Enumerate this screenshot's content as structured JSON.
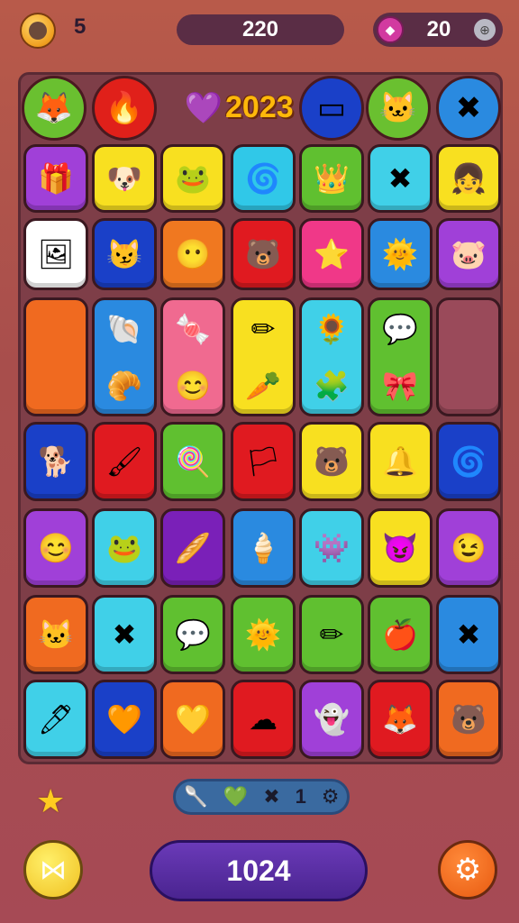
{
  "header": {
    "lives": "5",
    "score": "220",
    "gems": "20",
    "coin_icon": "coin-icon",
    "gem_icon": "gem-icon",
    "add_icon": "add-icon"
  },
  "board": {
    "year": "2023",
    "top_row": [
      {
        "icon": "fox-face-icon",
        "glyph": "🦊",
        "color": "#6ac030"
      },
      {
        "icon": "flame-icon",
        "glyph": "🔥",
        "color": "#e0201a"
      },
      {
        "icon": "heart-icon",
        "glyph": "💜",
        "color": "transparent"
      },
      {
        "icon": "eraser-icon",
        "glyph": "▭",
        "color": "#1a40c8"
      },
      {
        "icon": "cat-face-icon",
        "glyph": "🐱",
        "color": "#6ac030"
      },
      {
        "icon": "cross-icon",
        "glyph": "✖",
        "color": "#2a8ae0"
      }
    ],
    "rows": [
      [
        {
          "icon": "gift-icon",
          "glyph": "🎁",
          "color": "#a040d8"
        },
        {
          "icon": "dog-face-icon",
          "glyph": "🐶",
          "color": "#f8e020"
        },
        {
          "icon": "frog-face-icon",
          "glyph": "🐸",
          "color": "#f8e020"
        },
        {
          "icon": "swirl-icon",
          "glyph": "🌀",
          "color": "#30c8e8"
        },
        {
          "icon": "crown-icon",
          "glyph": "👑",
          "color": "#60c030"
        },
        {
          "icon": "cross-icon",
          "glyph": "✖",
          "color": "#40d0e8"
        },
        {
          "icon": "girl-face-icon",
          "glyph": "👧",
          "color": "#f8e020"
        }
      ],
      [
        {
          "icon": "frame-icon",
          "glyph": "🖼",
          "color": "#ffffff"
        },
        {
          "icon": "cat-face-icon",
          "glyph": "😼",
          "color": "#1a40c8"
        },
        {
          "icon": "ghost-face-icon",
          "glyph": "😶",
          "color": "#f07820"
        },
        {
          "icon": "bear-face-icon",
          "glyph": "🐻",
          "color": "#e01a20"
        },
        {
          "icon": "star-face-icon",
          "glyph": "⭐",
          "color": "#f03888"
        },
        {
          "icon": "sun-face-icon",
          "glyph": "🌞",
          "color": "#2a8ae0"
        },
        {
          "icon": "pig-face-icon",
          "glyph": "🐷",
          "color": "#a040d8"
        }
      ],
      [
        {
          "icon": "empty-tile",
          "glyph": "",
          "color": "#f06a20",
          "glyph2": ""
        },
        {
          "icon": "shell-icon",
          "glyph": "🐚",
          "color": "#2a8ae0",
          "glyph2": "🥐"
        },
        {
          "icon": "candy-icon",
          "glyph": "🍬",
          "color": "#f06a90",
          "glyph2": "😊"
        },
        {
          "icon": "pencil-icon",
          "glyph": "✏",
          "color": "#f8e020",
          "glyph2": "🥕"
        },
        {
          "icon": "gear-face-icon",
          "glyph": "🌻",
          "color": "#40d0e8",
          "glyph2": "🧩"
        },
        {
          "icon": "speech-bubble-icon",
          "glyph": "💬",
          "color": "#60c030",
          "glyph2": "🎀"
        },
        {
          "icon": "empty-tile",
          "glyph": "",
          "color": "#9a4a5a",
          "glyph2": ""
        }
      ],
      [
        {
          "icon": "dog-face-icon",
          "glyph": "🐕",
          "color": "#1a40c8"
        },
        {
          "icon": "brush-icon",
          "glyph": "🖌",
          "color": "#e01a20"
        },
        {
          "icon": "lollipop-icon",
          "glyph": "🍭",
          "color": "#60c030"
        },
        {
          "icon": "flag-icon",
          "glyph": "🏳",
          "color": "#e01a20"
        },
        {
          "icon": "bear-face-icon",
          "glyph": "🐻",
          "color": "#f8e020"
        },
        {
          "icon": "bell-icon",
          "glyph": "🔔",
          "color": "#f8e020"
        },
        {
          "icon": "swirl-icon",
          "glyph": "🌀",
          "color": "#1a40c8"
        }
      ],
      [
        {
          "icon": "smile-face-icon",
          "glyph": "😊",
          "color": "#a040d8"
        },
        {
          "icon": "frog-face-icon",
          "glyph": "🐸",
          "color": "#40d0e8"
        },
        {
          "icon": "bread-icon",
          "glyph": "🥖",
          "color": "#7a20b8"
        },
        {
          "icon": "icecream-icon",
          "glyph": "🍦",
          "color": "#2a8ae0"
        },
        {
          "icon": "monster-face-icon",
          "glyph": "👾",
          "color": "#40d0e8"
        },
        {
          "icon": "slime-face-icon",
          "glyph": "😈",
          "color": "#f8e020"
        },
        {
          "icon": "wink-face-icon",
          "glyph": "😉",
          "color": "#a040d8"
        }
      ],
      [
        {
          "icon": "cat-face-icon",
          "glyph": "🐱",
          "color": "#f06a20"
        },
        {
          "icon": "cross-icon",
          "glyph": "✖",
          "color": "#40d0e8"
        },
        {
          "icon": "speech-bubble-icon",
          "glyph": "💬",
          "color": "#60c030"
        },
        {
          "icon": "sun-face-icon",
          "glyph": "🌞",
          "color": "#60c030"
        },
        {
          "icon": "pencil-icon",
          "glyph": "✏",
          "color": "#60c030"
        },
        {
          "icon": "apple-icon",
          "glyph": "🍎",
          "color": "#60c030"
        },
        {
          "icon": "cross-icon",
          "glyph": "✖",
          "color": "#2a8ae0"
        }
      ],
      [
        {
          "icon": "pencil-icon",
          "glyph": "🖊",
          "color": "#40d0e8"
        },
        {
          "icon": "heart-icon",
          "glyph": "🧡",
          "color": "#1a40c8"
        },
        {
          "icon": "heart-icon",
          "glyph": "💛",
          "color": "#f06a20"
        },
        {
          "icon": "cloud-face-icon",
          "glyph": "☁",
          "color": "#e01a20"
        },
        {
          "icon": "monster-face-icon",
          "glyph": "👻",
          "color": "#a040d8"
        },
        {
          "icon": "fox-face-icon",
          "glyph": "🦊",
          "color": "#e01a20"
        },
        {
          "icon": "bear-face-icon",
          "glyph": "🐻",
          "color": "#f06a20"
        }
      ]
    ]
  },
  "footer": {
    "tray_icons": [
      "🥄",
      "💚",
      "✖"
    ],
    "tray_count": "1",
    "tray_gear": "⚙",
    "main_value": "1024",
    "star_icon": "★",
    "back_glyph": "⋈",
    "settings_glyph": "⚙"
  }
}
